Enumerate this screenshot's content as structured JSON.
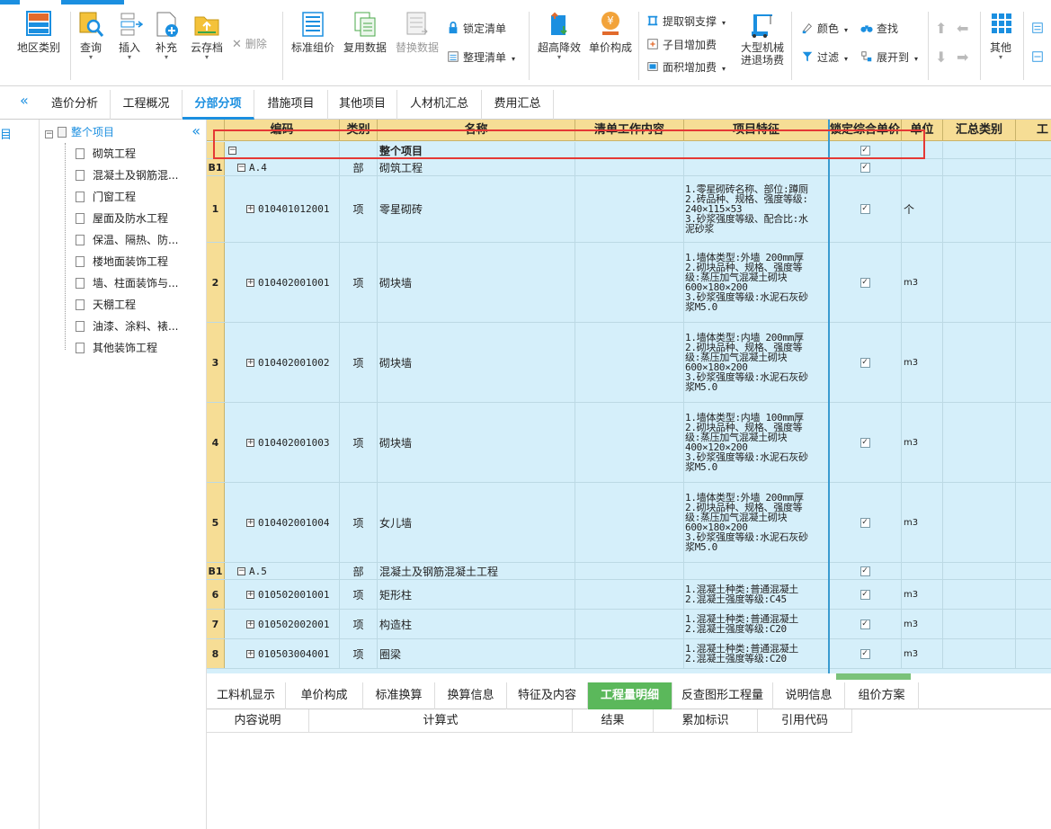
{
  "ribbon": {
    "region_type": "地区类别",
    "query": "查询",
    "insert": "插入",
    "supplement": "补充",
    "cloud_archive": "云存档",
    "delete": "删除",
    "standard_pricing": "标准组价",
    "reuse_data": "复用数据",
    "replace_data": "替换数据",
    "lock_list": "锁定清单",
    "arrange_list": "整理清单",
    "raise_lower_efficiency": "超高降效",
    "unit_price_composition": "单价构成",
    "extract_steel_support": "提取钢支撑",
    "subitem_add_fee": "子目增加费",
    "area_add_fee": "面积增加费",
    "large_machine_line1": "大型机械",
    "large_machine_line2": "进退场费",
    "color": "颜色",
    "find": "查找",
    "filter": "过滤",
    "expand_to": "展开到",
    "other": "其他"
  },
  "tabs": [
    "造价分析",
    "工程概况",
    "分部分项",
    "措施项目",
    "其他项目",
    "人材机汇总",
    "费用汇总"
  ],
  "active_tab": "分部分项",
  "left_edge_label": "目",
  "tree": {
    "root": "整个项目",
    "items": [
      "砌筑工程",
      "混凝土及钢筋混...",
      "门窗工程",
      "屋面及防水工程",
      "保温、隔热、防...",
      "楼地面装饰工程",
      "墙、柱面装饰与...",
      "天棚工程",
      "油漆、涂料、裱...",
      "其他装饰工程"
    ]
  },
  "grid": {
    "columns": [
      "",
      "编码",
      "类别",
      "名称",
      "清单工作内容",
      "项目特征",
      "锁定综合单价",
      "单位",
      "汇总类别",
      "工"
    ],
    "rows": [
      {
        "num": "",
        "code": "",
        "type": "",
        "name": "整个项目",
        "feature": "",
        "unit": "",
        "kind": "root"
      },
      {
        "num": "B1",
        "code": "A.4",
        "type": "部",
        "name": "砌筑工程",
        "feature": "",
        "unit": "",
        "kind": "part"
      },
      {
        "num": "1",
        "code": "010401012001",
        "type": "项",
        "name": "零星砌砖",
        "feature": "1.零星砌砖名称、部位:蹲厕\n2.砖品种、规格、强度等级:\n240×115×53\n3.砂浆强度等级、配合比:水\n泥砂浆",
        "unit": "个",
        "kind": "item"
      },
      {
        "num": "2",
        "code": "010402001001",
        "type": "项",
        "name": "砌块墙",
        "feature": "1.墙体类型:外墙 200mm厚\n2.砌块品种、规格、强度等\n级:蒸压加气混凝土砌块\n600×180×200\n3.砂浆强度等级:水泥石灰砂\n浆M5.0",
        "unit": "m3",
        "kind": "item"
      },
      {
        "num": "3",
        "code": "010402001002",
        "type": "项",
        "name": "砌块墙",
        "feature": "1.墙体类型:内墙 200mm厚\n2.砌块品种、规格、强度等\n级:蒸压加气混凝土砌块\n600×180×200\n3.砂浆强度等级:水泥石灰砂\n浆M5.0",
        "unit": "m3",
        "kind": "item"
      },
      {
        "num": "4",
        "code": "010402001003",
        "type": "项",
        "name": "砌块墙",
        "feature": "1.墙体类型:内墙 100mm厚\n2.砌块品种、规格、强度等\n级:蒸压加气混凝土砌块\n400×120×200\n3.砂浆强度等级:水泥石灰砂\n浆M5.0",
        "unit": "m3",
        "kind": "item"
      },
      {
        "num": "5",
        "code": "010402001004",
        "type": "项",
        "name": "女儿墙",
        "feature": "1.墙体类型:外墙 200mm厚\n2.砌块品种、规格、强度等\n级:蒸压加气混凝土砌块\n600×180×200\n3.砂浆强度等级:水泥石灰砂\n浆M5.0",
        "unit": "m3",
        "kind": "item"
      },
      {
        "num": "B1",
        "code": "A.5",
        "type": "部",
        "name": "混凝土及钢筋混凝土工程",
        "feature": "",
        "unit": "",
        "kind": "part"
      },
      {
        "num": "6",
        "code": "010502001001",
        "type": "项",
        "name": "矩形柱",
        "feature": "1.混凝土种类:普通混凝土\n2.混凝土强度等级:C45",
        "unit": "m3",
        "kind": "item"
      },
      {
        "num": "7",
        "code": "010502002001",
        "type": "项",
        "name": "构造柱",
        "feature": "1.混凝土种类:普通混凝土\n2.混凝土强度等级:C20",
        "unit": "m3",
        "kind": "item"
      },
      {
        "num": "8",
        "code": "010503004001",
        "type": "项",
        "name": "圈梁",
        "feature": "1.混凝土种类:普通混凝土\n2.混凝土强度等级:C20",
        "unit": "m3",
        "kind": "item"
      }
    ]
  },
  "bottom_tabs": [
    "工料机显示",
    "单价构成",
    "标准换算",
    "换算信息",
    "特征及内容",
    "工程量明细",
    "反查图形工程量",
    "说明信息",
    "组价方案"
  ],
  "bottom_active": "工程量明细",
  "detail_columns": [
    "内容说明",
    "计算式",
    "结果",
    "累加标识",
    "引用代码"
  ],
  "colors": {
    "accent": "#1b8fe0",
    "header": "#f6dd95",
    "grid_bg": "#d5effa",
    "highlight": "#e53935",
    "active_bottom": "#5bb85b"
  }
}
